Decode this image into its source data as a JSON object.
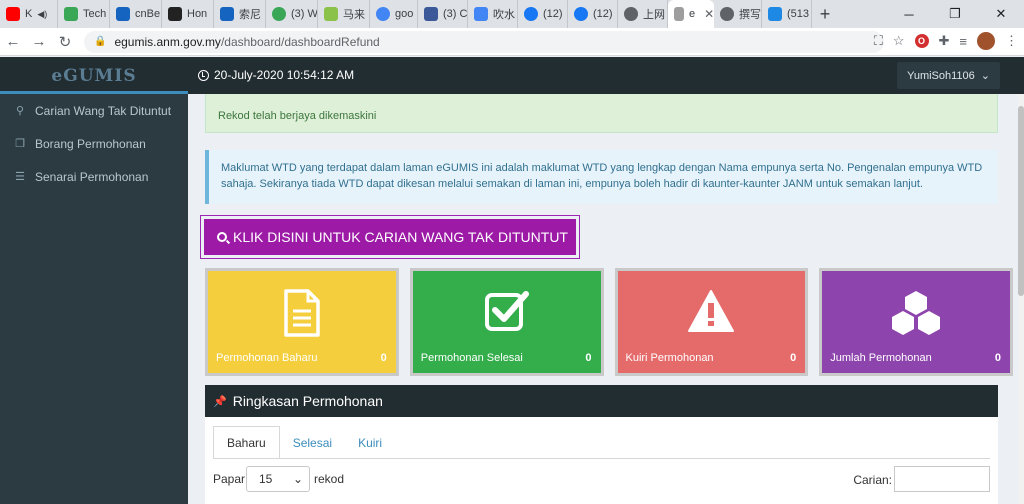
{
  "browser": {
    "tabs": [
      {
        "label": "K",
        "color": "#ff0000"
      },
      {
        "label": "Tech",
        "color": "#3aa757"
      },
      {
        "label": "cnBe",
        "color": "#1565c0"
      },
      {
        "label": "Hon",
        "color": "#222222"
      },
      {
        "label": "索尼",
        "color": "#1565c0"
      },
      {
        "label": "(3) W",
        "color": "#3aa757"
      },
      {
        "label": "马来",
        "color": "#8bc34a"
      },
      {
        "label": "goo",
        "color": "#4285f4"
      },
      {
        "label": "(3) C",
        "color": "#3b5998"
      },
      {
        "label": "吹水",
        "color": "#4285f4"
      },
      {
        "label": "(12)",
        "color": "#1877f2"
      },
      {
        "label": "(12)",
        "color": "#1877f2"
      },
      {
        "label": "上网",
        "color": "#5f6368"
      },
      {
        "label": "e",
        "color": "#9e9e9e",
        "active": true
      },
      {
        "label": "撰写",
        "color": "#5f6368"
      },
      {
        "label": "(513",
        "color": "#1e88e5"
      }
    ],
    "new_tab": "+",
    "url_host": "egumis.anm.gov.my",
    "url_path": "/dashboard/dashboardRefund"
  },
  "header": {
    "brand": "eGUMIS",
    "datetime": "20-July-2020 10:54:12 AM",
    "user": "YumiSoh1106"
  },
  "sidebar": {
    "items": [
      {
        "label": "Carian Wang Tak Dituntut"
      },
      {
        "label": "Borang Permohonan"
      },
      {
        "label": "Senarai Permohonan"
      }
    ]
  },
  "main": {
    "success_message": "Rekod telah berjaya dikemaskini",
    "info_text": "Maklumat WTD yang terdapat dalam laman eGUMIS ini adalah maklumat WTD yang lengkap dengan Nama empunya serta No. Pengenalan empunya WTD sahaja. Sekiranya tiada WTD dapat dikesan melalui semakan di laman ini, empunya boleh hadir di kaunter-kaunter JANM untuk semakan lanjut.",
    "search_button": "KLIK DISINI UNTUK CARIAN WANG TAK DITUNTUT",
    "stats": [
      {
        "label": "Permohonan Baharu",
        "count": "0",
        "color": "#f4ce3c",
        "icon": "document-icon"
      },
      {
        "label": "Permohonan Selesai",
        "count": "0",
        "color": "#34ad4b",
        "icon": "check-square-icon"
      },
      {
        "label": "Kuiri Permohonan",
        "count": "0",
        "color": "#e56b6b",
        "icon": "warning-icon"
      },
      {
        "label": "Jumlah Permohonan",
        "count": "0",
        "color": "#8e44ad",
        "icon": "cubes-icon"
      }
    ],
    "summary": {
      "title": "Ringkasan Permohonan",
      "tabs": [
        "Baharu",
        "Selesai",
        "Kuiri"
      ],
      "papar_label": "Papar",
      "page_size": "15",
      "rekod_label": "rekod",
      "carian_label": "Carian:"
    }
  }
}
